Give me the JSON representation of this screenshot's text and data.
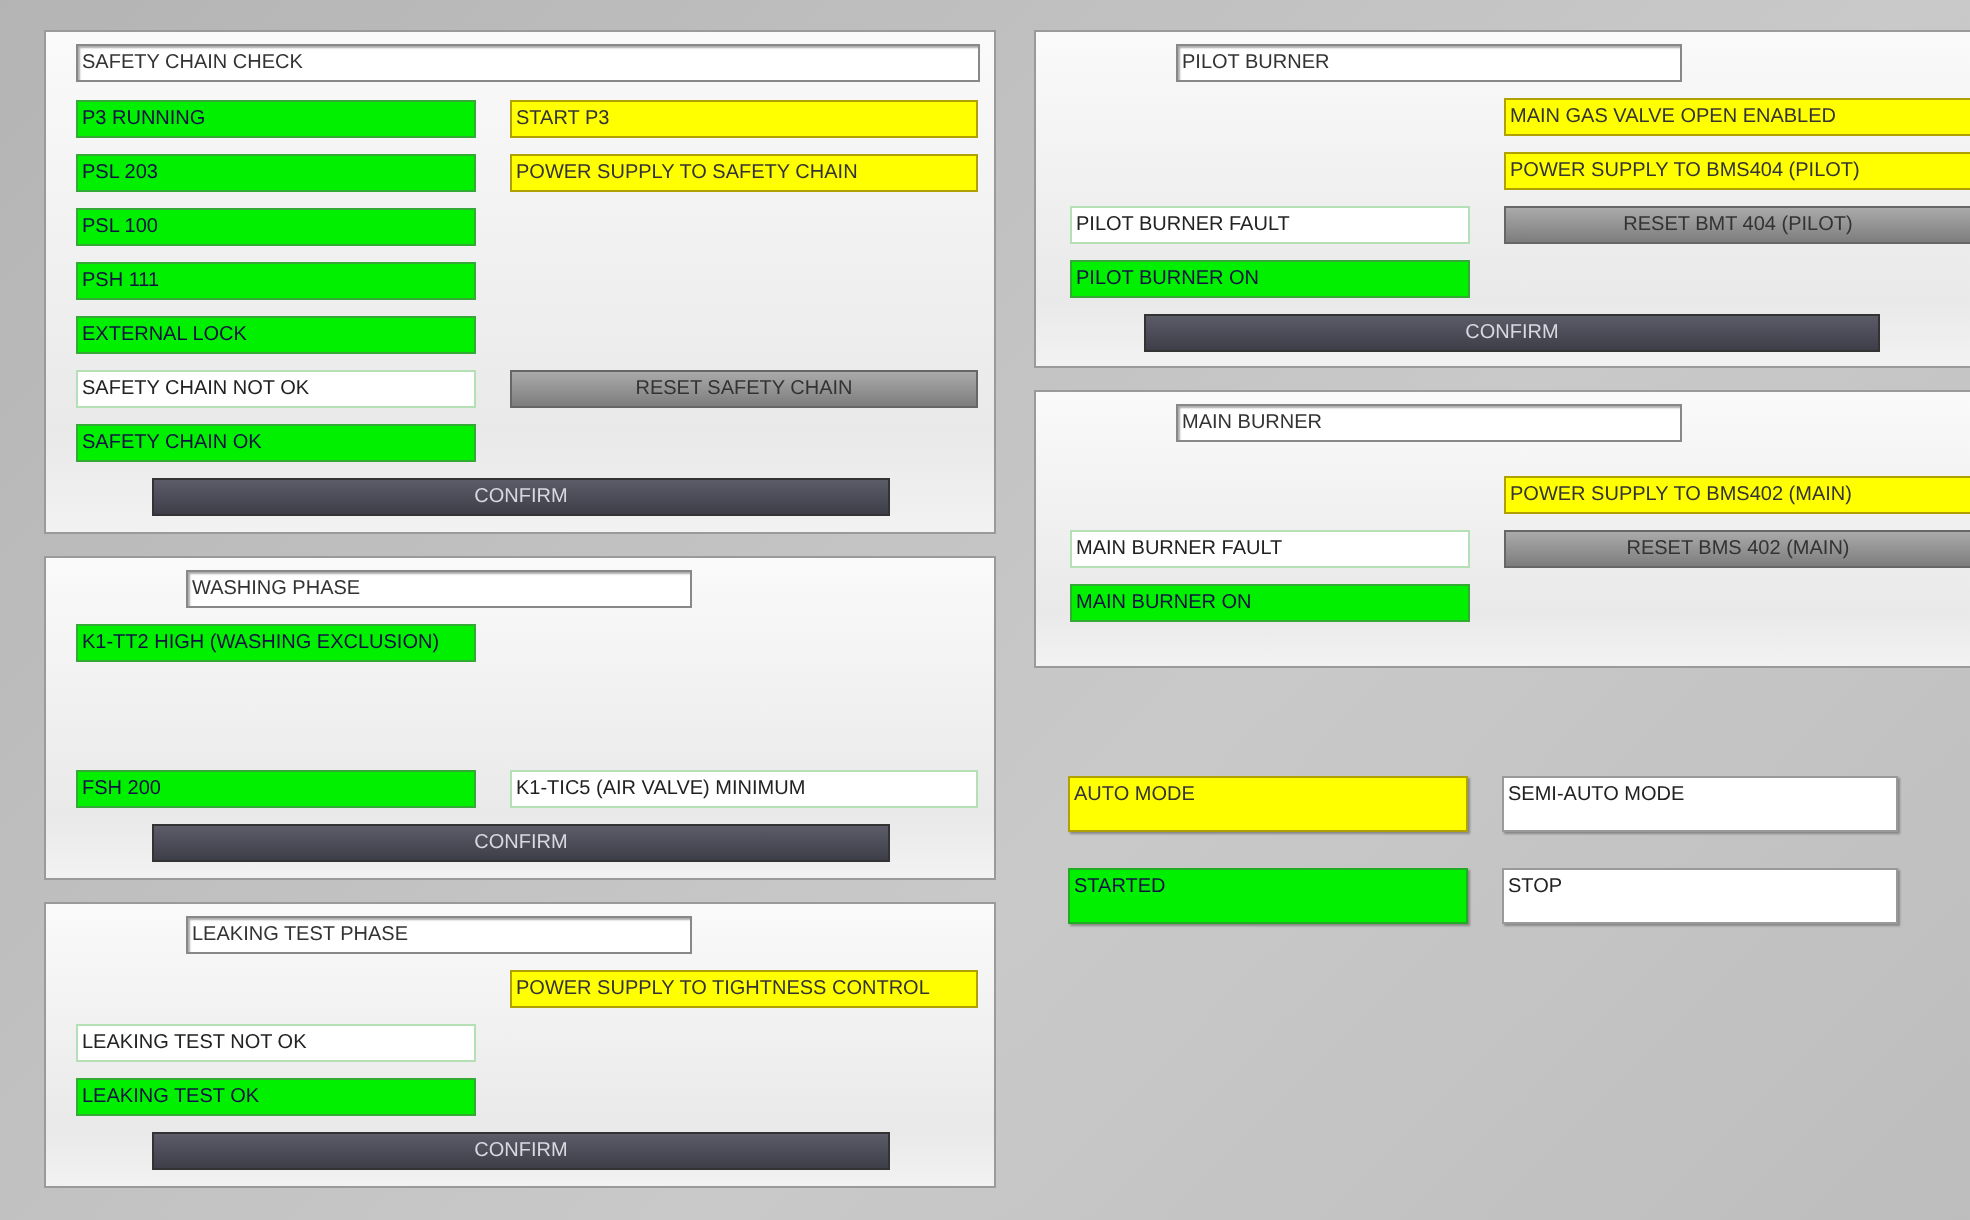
{
  "panels": [
    {
      "title": "SAFETY CHAIN CHECK",
      "rows": [
        {
          "left": {
            "kind": "status",
            "label": "P3 RUNNING",
            "active": true
          },
          "right": {
            "kind": "signal",
            "label": "START P3"
          }
        },
        {
          "left": {
            "kind": "status",
            "label": "PSL 203",
            "active": true
          },
          "right": {
            "kind": "signal",
            "label": "POWER SUPPLY TO SAFETY CHAIN"
          }
        },
        {
          "left": {
            "kind": "status",
            "label": "PSL 100",
            "active": true
          }
        },
        {
          "left": {
            "kind": "status",
            "label": "PSH 111",
            "active": true
          }
        },
        {
          "left": {
            "kind": "status",
            "label": "EXTERNAL LOCK",
            "active": true
          }
        },
        {
          "left": {
            "kind": "status",
            "label": "SAFETY CHAIN NOT OK",
            "active": false
          },
          "right": {
            "kind": "button",
            "label": "RESET SAFETY CHAIN"
          }
        },
        {
          "left": {
            "kind": "status",
            "label": "SAFETY CHAIN OK",
            "active": true
          }
        }
      ],
      "confirm": "CONFIRM"
    },
    {
      "title": "WASHING PHASE",
      "rows": [
        {
          "left": {
            "kind": "status",
            "label": "K1-TT2 HIGH (WASHING EXCLUSION)",
            "active": true
          }
        },
        {
          "left": {
            "kind": "status",
            "label": "FSH 200",
            "active": true
          },
          "right": {
            "kind": "status",
            "label": "K1-TIC5 (AIR VALVE)  MINIMUM",
            "active": false
          }
        }
      ],
      "confirm": "CONFIRM"
    },
    {
      "title": "LEAKING TEST PHASE",
      "rows": [
        {
          "right": {
            "kind": "signal",
            "label": "POWER SUPPLY TO TIGHTNESS CONTROL"
          }
        },
        {
          "left": {
            "kind": "status",
            "label": "LEAKING TEST NOT OK",
            "active": false
          }
        },
        {
          "left": {
            "kind": "status",
            "label": "LEAKING TEST OK",
            "active": true
          }
        }
      ],
      "confirm": "CONFIRM"
    },
    {
      "title": "PILOT BURNER",
      "rows": [
        {
          "right": {
            "kind": "signal",
            "label": "MAIN GAS VALVE OPEN ENABLED"
          }
        },
        {
          "right": {
            "kind": "signal",
            "label": "POWER SUPPLY TO BMS404 (PILOT)"
          }
        },
        {
          "left": {
            "kind": "status",
            "label": "PILOT BURNER FAULT",
            "active": false
          },
          "right": {
            "kind": "button",
            "label": "RESET BMT 404 (PILOT)"
          }
        },
        {
          "left": {
            "kind": "status",
            "label": "PILOT BURNER ON",
            "active": true
          }
        }
      ],
      "confirm": "CONFIRM"
    },
    {
      "title": "MAIN BURNER",
      "rows": [
        {
          "right": {
            "kind": "signal",
            "label": "POWER SUPPLY TO BMS402 (MAIN)"
          }
        },
        {
          "left": {
            "kind": "status",
            "label": "MAIN BURNER FAULT",
            "active": false
          },
          "right": {
            "kind": "button",
            "label": "RESET BMS 402 (MAIN)"
          }
        },
        {
          "left": {
            "kind": "status",
            "label": "MAIN BURNER ON",
            "active": true
          }
        }
      ]
    }
  ],
  "modes": [
    {
      "kind": "signal",
      "label": "AUTO MODE"
    },
    {
      "kind": "status",
      "label": "SEMI-AUTO MODE",
      "active": false
    },
    {
      "kind": "status",
      "label": "STARTED",
      "active": true
    },
    {
      "kind": "status",
      "label": "STOP",
      "active": false
    }
  ]
}
